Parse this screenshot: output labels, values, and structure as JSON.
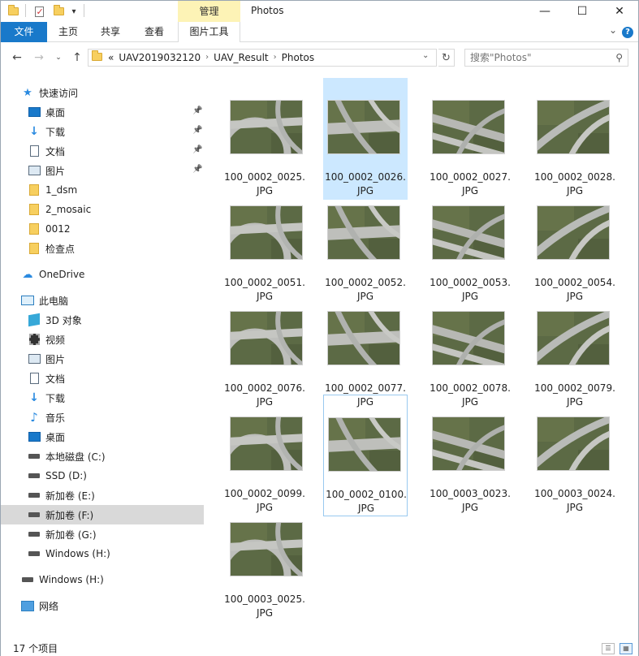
{
  "window": {
    "title": "Photos",
    "context_tab_group": "管理",
    "controls": {
      "minimize": "—",
      "maximize": "☐",
      "close": "✕"
    }
  },
  "ribbon": {
    "tabs": [
      {
        "label": "文件",
        "active": true
      },
      {
        "label": "主页"
      },
      {
        "label": "共享"
      },
      {
        "label": "查看"
      },
      {
        "label": "图片工具"
      }
    ],
    "help": "?",
    "collapse": "⌄"
  },
  "address": {
    "prefix": "«",
    "crumbs": [
      "UAV2019032120",
      "UAV_Result",
      "Photos"
    ],
    "separator": "›"
  },
  "search": {
    "placeholder": "搜索\"Photos\""
  },
  "sidebar": {
    "items": [
      {
        "label": "快速访问",
        "icon": "star-icon"
      },
      {
        "label": "桌面",
        "icon": "desktop-icon",
        "pinned": true
      },
      {
        "label": "下载",
        "icon": "download-icon",
        "pinned": true
      },
      {
        "label": "文档",
        "icon": "document-icon",
        "pinned": true
      },
      {
        "label": "图片",
        "icon": "picture-icon",
        "pinned": true
      },
      {
        "label": "1_dsm",
        "icon": "folder-icon"
      },
      {
        "label": "2_mosaic",
        "icon": "folder-icon"
      },
      {
        "label": "0012",
        "icon": "folder-icon"
      },
      {
        "label": "检查点",
        "icon": "folder-icon"
      },
      {
        "label": "OneDrive",
        "icon": "cloud-icon"
      },
      {
        "label": "此电脑",
        "icon": "computer-icon"
      },
      {
        "label": "3D 对象",
        "icon": "cube-icon"
      },
      {
        "label": "视频",
        "icon": "video-icon"
      },
      {
        "label": "图片",
        "icon": "picture-icon"
      },
      {
        "label": "文档",
        "icon": "document-icon"
      },
      {
        "label": "下载",
        "icon": "download-icon"
      },
      {
        "label": "音乐",
        "icon": "music-icon"
      },
      {
        "label": "桌面",
        "icon": "desktop-icon"
      },
      {
        "label": "本地磁盘 (C:)",
        "icon": "drive-icon"
      },
      {
        "label": "SSD (D:)",
        "icon": "drive-icon"
      },
      {
        "label": "新加卷 (E:)",
        "icon": "drive-icon"
      },
      {
        "label": "新加卷 (F:)",
        "icon": "drive-icon",
        "selected": true
      },
      {
        "label": "新加卷 (G:)",
        "icon": "drive-icon"
      },
      {
        "label": "Windows (H:)",
        "icon": "drive-icon"
      },
      {
        "label": "Windows (H:)",
        "icon": "drive-icon"
      },
      {
        "label": "网络",
        "icon": "network-icon"
      }
    ]
  },
  "files": [
    {
      "line1": "100_0002_0025.",
      "line2": "JPG"
    },
    {
      "line1": "100_0002_0026.",
      "line2": "JPG",
      "selected": true
    },
    {
      "line1": "100_0002_0027.",
      "line2": "JPG"
    },
    {
      "line1": "100_0002_0028.",
      "line2": "JPG"
    },
    {
      "line1": "100_0002_0051.",
      "line2": "JPG"
    },
    {
      "line1": "100_0002_0052.",
      "line2": "JPG"
    },
    {
      "line1": "100_0002_0053.",
      "line2": "JPG"
    },
    {
      "line1": "100_0002_0054.",
      "line2": "JPG"
    },
    {
      "line1": "100_0002_0076.",
      "line2": "JPG"
    },
    {
      "line1": "100_0002_0077.",
      "line2": "JPG"
    },
    {
      "line1": "100_0002_0078.",
      "line2": "JPG"
    },
    {
      "line1": "100_0002_0079.",
      "line2": "JPG"
    },
    {
      "line1": "100_0002_0099.",
      "line2": "JPG"
    },
    {
      "line1": "100_0002_0100.",
      "line2": "JPG",
      "focused": true
    },
    {
      "line1": "100_0003_0023.",
      "line2": "JPG"
    },
    {
      "line1": "100_0003_0024.",
      "line2": "JPG"
    },
    {
      "line1": "100_0003_0025.",
      "line2": "JPG"
    }
  ],
  "status": {
    "item_count": "17 个项目"
  },
  "colors": {
    "accent": "#1979ca",
    "context_tab": "#fdf3b6",
    "selection": "#cce8ff",
    "sidebar_selection": "#d9d9d9"
  }
}
